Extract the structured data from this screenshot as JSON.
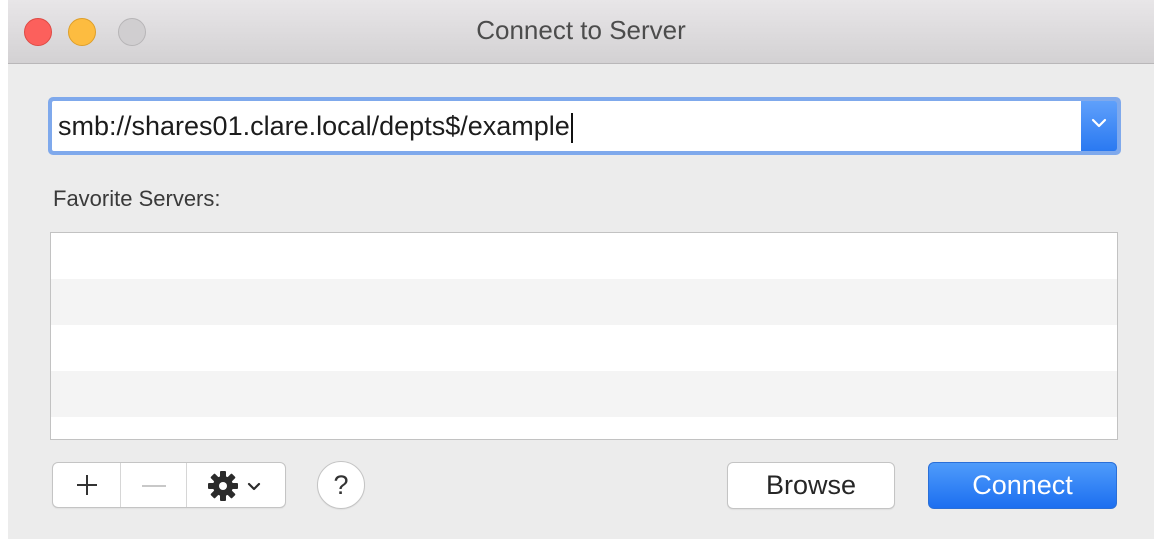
{
  "window": {
    "title": "Connect to Server"
  },
  "address": {
    "value": "smb://shares01.clare.local/depts$/example"
  },
  "favorites": {
    "label": "Favorite Servers:",
    "items": []
  },
  "toolbar": {
    "add_icon": "plus-icon",
    "remove_icon": "minus-icon",
    "action_icon": "gear-icon",
    "help_label": "?"
  },
  "buttons": {
    "browse_label": "Browse",
    "connect_label": "Connect"
  },
  "colors": {
    "accent": "#2a79f1",
    "focus_ring": "#7fa9ec",
    "close": "#fc605c",
    "minimize": "#fdbc40"
  }
}
